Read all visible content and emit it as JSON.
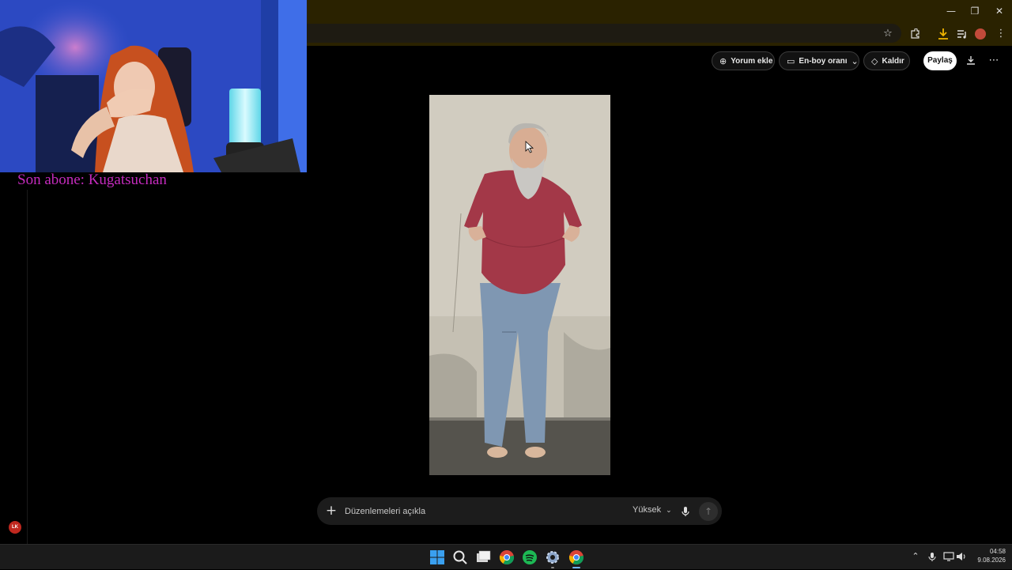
{
  "stream_overlay": {
    "subscriber_banner": "Son abone: Kugatsuchan",
    "badge": "LK"
  },
  "browser": {
    "window_controls": {
      "minimize": "—",
      "restore": "❐",
      "close": "✕"
    }
  },
  "editor": {
    "actions": {
      "comment": "Yorum ekle",
      "aspect_ratio": "En-boy oranı",
      "remove": "Kaldır",
      "share": "Paylaş"
    }
  },
  "prompt": {
    "placeholder": "Düzenlemeleri açıkla",
    "quality": "Yüksek"
  },
  "taskbar": {
    "time": "04:58",
    "date": "9.08.2026"
  },
  "colors": {
    "banner": "#c42bbd",
    "chrome_bar": "#2a2200",
    "download_accent": "#f0b400"
  }
}
